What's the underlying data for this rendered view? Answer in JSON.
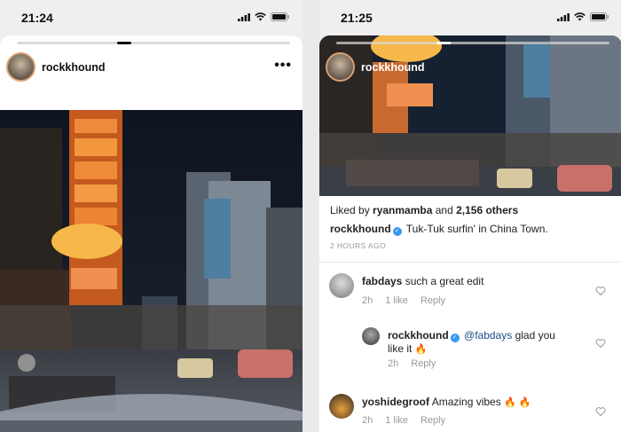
{
  "left": {
    "status": {
      "time": "21:24"
    },
    "post": {
      "username": "rockkhound",
      "more_icon": "more-horizontal-icon"
    }
  },
  "right": {
    "status": {
      "time": "21:25"
    },
    "post": {
      "username": "rockkhound",
      "likes_prefix": "Liked by ",
      "liked_by_user": "ryanmamba",
      "likes_middle": " and ",
      "likes_count": "2,156 others",
      "caption_user": "rockkhound",
      "caption_text": "Tuk-Tuk surfin' in China Town.",
      "time_ago": "2 HOURS AGO"
    },
    "comments": [
      {
        "user": "fabdays",
        "text": "such a great edit",
        "time": "2h",
        "likes": "1 like",
        "reply": "Reply"
      },
      {
        "user": "rockkhound",
        "mention": "@fabdays",
        "text": "glad you",
        "text2": "like it",
        "flame": "🔥",
        "time": "2h",
        "reply": "Reply"
      },
      {
        "user": "yoshidegroof",
        "text": "Amazing vibes",
        "flames": "🔥 🔥",
        "time": "2h",
        "likes": "1 like",
        "reply": "Reply"
      }
    ]
  },
  "colors": {
    "verified": "#3897f0",
    "mention": "#1b4d87",
    "avatar_ring": "#d8a074"
  }
}
